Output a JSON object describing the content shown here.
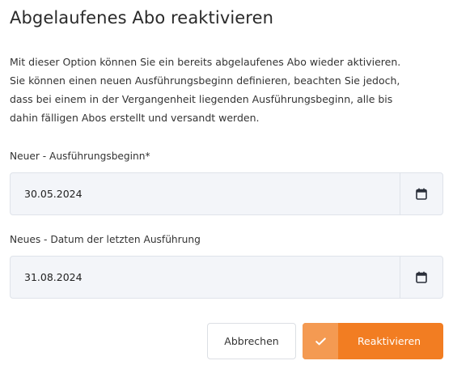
{
  "dialog": {
    "title": "Abgelaufenes Abo reaktivieren",
    "description_lines": [
      "Mit dieser Option können Sie ein bereits abgelaufenes Abo wieder aktivieren.",
      "Sie können einen neuen Ausführungsbeginn definieren, beachten Sie jedoch,",
      "dass bei einem in der Vergangenheit liegenden Ausführungsbeginn, alle bis",
      "dahin fälligen Abos erstellt und versandt werden."
    ]
  },
  "fields": {
    "start": {
      "label": "Neuer - Ausführungsbeginn*",
      "value": "30.05.2024",
      "icon": "calendar-icon"
    },
    "last": {
      "label": "Neues - Datum der letzten Ausführung",
      "value": "31.08.2024",
      "icon": "calendar-icon"
    }
  },
  "actions": {
    "cancel_label": "Abbrechen",
    "confirm_label": "Reaktivieren",
    "confirm_icon": "check-icon"
  },
  "colors": {
    "accent": "#f27d22",
    "accent_light": "#f49a52",
    "field_bg": "#f3f5f9"
  }
}
